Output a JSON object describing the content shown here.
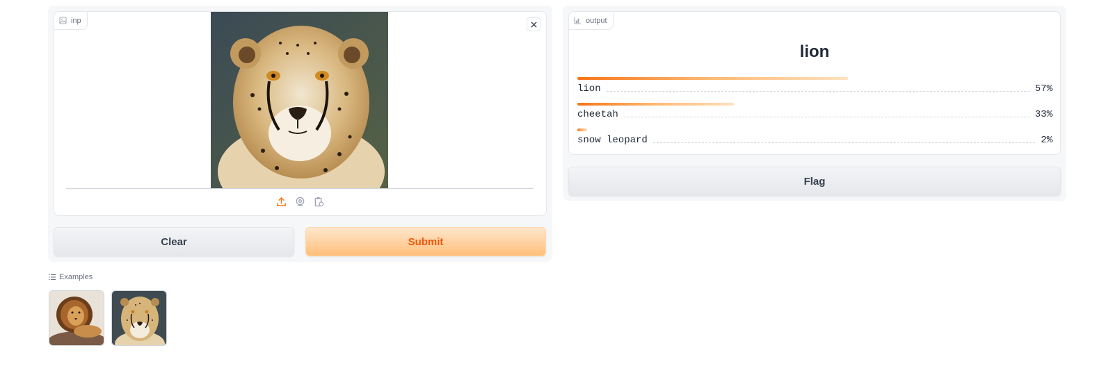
{
  "input": {
    "label": "inp",
    "image_subject": "cheetah"
  },
  "buttons": {
    "clear": "Clear",
    "submit": "Submit",
    "flag": "Flag"
  },
  "output": {
    "label": "output",
    "predicted": "lion",
    "confidences": [
      {
        "label": "lion",
        "percent_text": "57%",
        "value": 0.57
      },
      {
        "label": "cheetah",
        "percent_text": "33%",
        "value": 0.33
      },
      {
        "label": "snow leopard",
        "percent_text": "2%",
        "value": 0.02
      }
    ]
  },
  "examples": {
    "header": "Examples",
    "items": [
      "lion",
      "cheetah"
    ]
  },
  "colors": {
    "accent": "#f97316",
    "submit_text": "#ea580c"
  }
}
